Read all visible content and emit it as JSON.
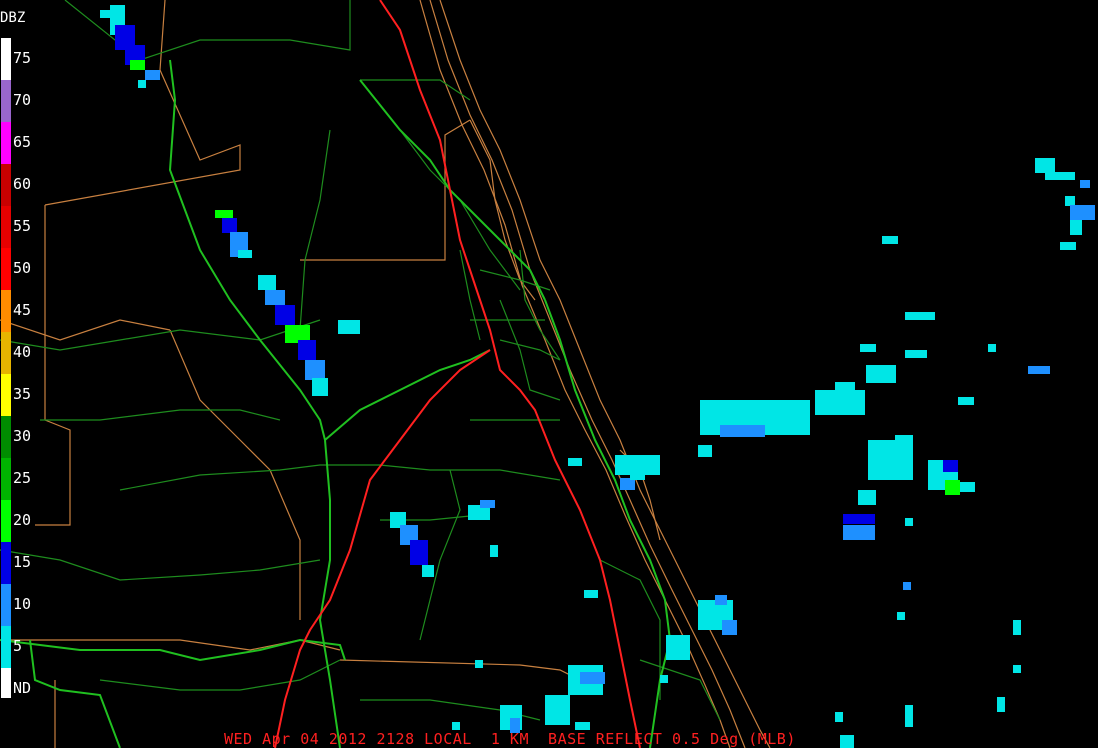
{
  "legend": {
    "title": "DBZ",
    "levels": [
      {
        "label": "75",
        "color": "#ffffff"
      },
      {
        "label": "70",
        "color": "#9966cc"
      },
      {
        "label": "65",
        "color": "#ff00ff"
      },
      {
        "label": "60",
        "color": "#c80000"
      },
      {
        "label": "55",
        "color": "#e60000"
      },
      {
        "label": "50",
        "color": "#ff0000"
      },
      {
        "label": "45",
        "color": "#ff8c00"
      },
      {
        "label": "40",
        "color": "#e6b400"
      },
      {
        "label": "35",
        "color": "#ffff00"
      },
      {
        "label": "30",
        "color": "#008c00"
      },
      {
        "label": "25",
        "color": "#00b400"
      },
      {
        "label": "20",
        "color": "#00ff00"
      },
      {
        "label": "15",
        "color": "#0000e6"
      },
      {
        "label": "10",
        "color": "#1e90ff"
      },
      {
        "label": "5",
        "color": "#00e6e6"
      },
      {
        "label": "ND",
        "color": "#000000"
      }
    ]
  },
  "footer": {
    "text": "WED Apr 04 2012 2128 LOCAL  1 KM  BASE REFLECT 0.5 Deg (MLB)"
  },
  "colors": {
    "background": "#000000",
    "county_lines": "#c88040",
    "roads_minor": "#1e8c1e",
    "roads_major": "#20c020",
    "interstate": "#ff2020",
    "coast": "#c88040"
  }
}
